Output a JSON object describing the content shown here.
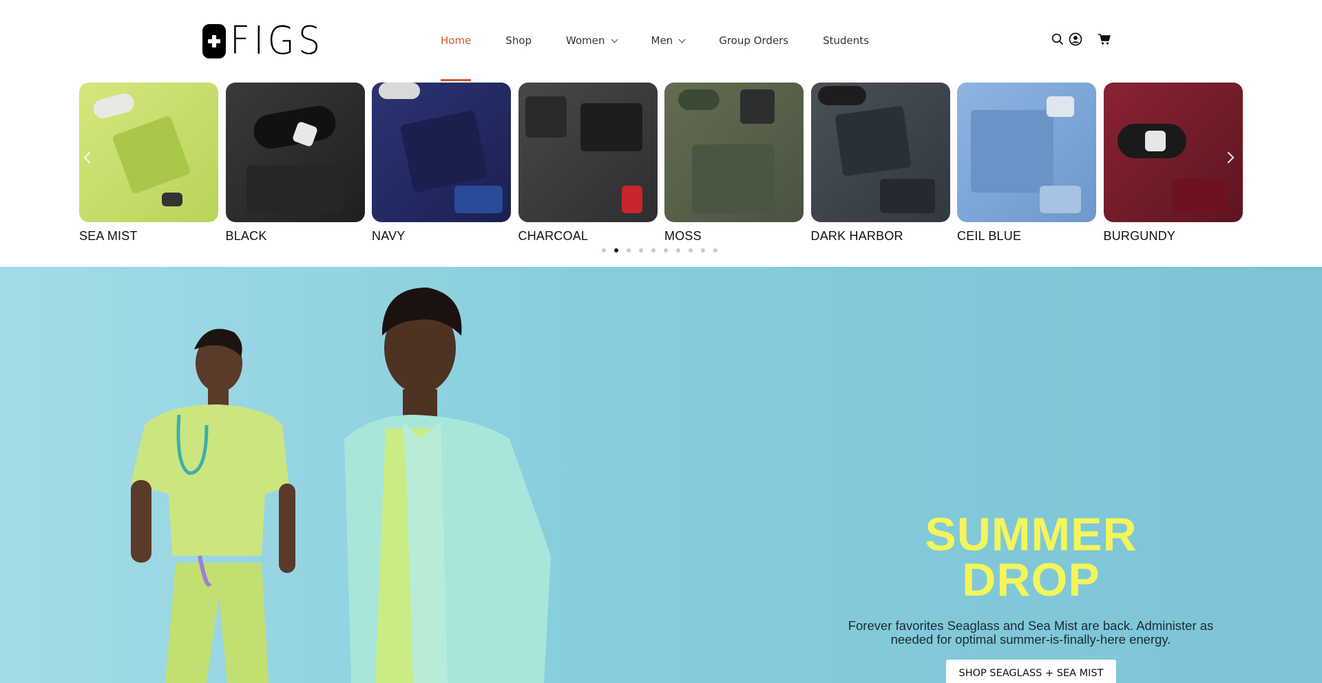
{
  "header": {
    "logo_text": "FIGS",
    "nav": [
      {
        "label": "Home",
        "active": true
      },
      {
        "label": "Shop"
      },
      {
        "label": "Women",
        "dropdown": true
      },
      {
        "label": "Men",
        "dropdown": true
      },
      {
        "label": "Group Orders"
      },
      {
        "label": "Students"
      }
    ],
    "icons": [
      "search-icon",
      "account-icon",
      "cart-icon"
    ],
    "accent_color": "#d4542b"
  },
  "carousel": {
    "items": [
      {
        "label": "SEA MIST",
        "color": "#c9de6e"
      },
      {
        "label": "BLACK",
        "color": "#2b2b2b"
      },
      {
        "label": "NAVY",
        "color": "#22285a"
      },
      {
        "label": "CHARCOAL",
        "color": "#3a3a3c"
      },
      {
        "label": "MOSS",
        "color": "#545d45"
      },
      {
        "label": "DARK HARBOR",
        "color": "#3c434c"
      },
      {
        "label": "CEIL BLUE",
        "color": "#7fa8d8"
      },
      {
        "label": "BURGUNDY",
        "color": "#6f1a26"
      }
    ],
    "dots_total": 10,
    "active_dot": 1
  },
  "hero": {
    "title_line1": "SUMMER",
    "title_line2": "DROP",
    "subtitle": "Forever favorites Seaglass and Sea Mist are back. Administer as needed for optimal summer-is-finally-here energy.",
    "cta_label": "SHOP SEAGLASS + SEA MIST",
    "title_color": "#f4f55b"
  }
}
